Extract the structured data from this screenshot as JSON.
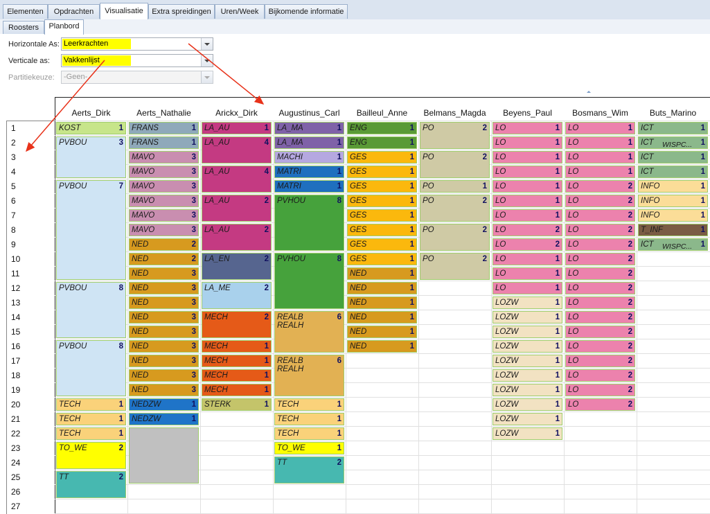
{
  "tabs": [
    "Elementen",
    "Opdrachten",
    "Visualisatie",
    "Extra spreidingen",
    "Uren/Week",
    "Bijkomende informatie"
  ],
  "active_tab": "Visualisatie",
  "subtabs": [
    "Roosters",
    "Planbord"
  ],
  "active_subtab": "Planbord",
  "filters": {
    "horizontal_label": "Horizontale As:",
    "horizontal_value": "Leerkrachten",
    "vertical_label": "Verticale as:",
    "vertical_value": "Vakkenlijst",
    "partition_label": "Partitiekeuze:",
    "partition_value": "-Geen-",
    "highlight_color": "#ffff00"
  },
  "columns": [
    "Aerts_Dirk",
    "Aerts_Nathalie",
    "Arickx_Dirk",
    "Augustinus_Carl",
    "Bailleul_Anne",
    "Belmans_Magda",
    "Beyens_Paul",
    "Bosmans_Wim",
    "Buts_Marino"
  ],
  "rows": [
    "1",
    "2",
    "3",
    "4",
    "5",
    "6",
    "7",
    "8",
    "9",
    "10",
    "11",
    "12",
    "13",
    "14",
    "15",
    "16",
    "17",
    "18",
    "19",
    "20",
    "21",
    "22",
    "23",
    "24",
    "25",
    "26",
    "27"
  ],
  "colors": {
    "KOST": "#c7e58a",
    "PVBOU": "#cfe4f4",
    "TECH": "#fad27a",
    "TO_WE": "#ffff00",
    "TT": "#47b8b0",
    "FRANS": "#8fa9ba",
    "MAVO": "#c98eb0",
    "NED": "#d79a1f",
    "NEDZW": "#1f74c8",
    "GRIJS": "#c0c0c0",
    "LA_AU": "#c43a82",
    "LA_EN": "#56658f",
    "LA_ME": "#a9d1ec",
    "MECH": "#e55a18",
    "STERK": "#c4c46a",
    "LA_MA": "#7f62a8",
    "MACHI": "#b5a8e0",
    "MATRI": "#1f6fbf",
    "PVHOU": "#46a23c",
    "REALB": "#e2b153",
    "ENG": "#5a9a36",
    "GES": "#fbb80d",
    "PO": "#cfcaa5",
    "LO": "#ec82ad",
    "LOZW": "#f2e2c2",
    "ICT": "#8bb88b",
    "INFO": "#fbdd98",
    "T_INF": "#7a5c44"
  },
  "blocks": [
    {
      "col": 0,
      "row": 1,
      "span": 1,
      "name": "KOST",
      "count": "1",
      "color": "KOST"
    },
    {
      "col": 0,
      "row": 2,
      "span": 3,
      "name": "PVBOU",
      "count": "3",
      "color": "PVBOU"
    },
    {
      "col": 0,
      "row": 5,
      "span": 7,
      "name": "PVBOU",
      "count": "7",
      "color": "PVBOU"
    },
    {
      "col": 0,
      "row": 12,
      "span": 4,
      "name": "PVBOU",
      "count": "8",
      "color": "PVBOU"
    },
    {
      "col": 0,
      "row": 16,
      "span": 4,
      "name": "PVBOU",
      "count": "8",
      "color": "PVBOU"
    },
    {
      "col": 0,
      "row": 20,
      "span": 1,
      "name": "TECH",
      "count": "1",
      "color": "TECH"
    },
    {
      "col": 0,
      "row": 21,
      "span": 1,
      "name": "TECH",
      "count": "1",
      "color": "TECH"
    },
    {
      "col": 0,
      "row": 22,
      "span": 1,
      "name": "TECH",
      "count": "1",
      "color": "TECH"
    },
    {
      "col": 0,
      "row": 23,
      "span": 2,
      "name": "TO_WE",
      "count": "2",
      "color": "TO_WE"
    },
    {
      "col": 0,
      "row": 25,
      "span": 2,
      "name": "TT",
      "count": "2",
      "color": "TT"
    },
    {
      "col": 1,
      "row": 1,
      "span": 1,
      "name": "FRANS",
      "count": "1",
      "color": "FRANS"
    },
    {
      "col": 1,
      "row": 2,
      "span": 1,
      "name": "FRANS",
      "count": "1",
      "color": "FRANS"
    },
    {
      "col": 1,
      "row": 3,
      "span": 1,
      "name": "MAVO",
      "count": "3",
      "color": "MAVO"
    },
    {
      "col": 1,
      "row": 4,
      "span": 1,
      "name": "MAVO",
      "count": "3",
      "color": "MAVO"
    },
    {
      "col": 1,
      "row": 5,
      "span": 1,
      "name": "MAVO",
      "count": "3",
      "color": "MAVO"
    },
    {
      "col": 1,
      "row": 6,
      "span": 1,
      "name": "MAVO",
      "count": "3",
      "color": "MAVO"
    },
    {
      "col": 1,
      "row": 7,
      "span": 1,
      "name": "MAVO",
      "count": "3",
      "color": "MAVO"
    },
    {
      "col": 1,
      "row": 8,
      "span": 1,
      "name": "MAVO",
      "count": "3",
      "color": "MAVO"
    },
    {
      "col": 1,
      "row": 9,
      "span": 1,
      "name": "NED",
      "count": "2",
      "color": "NED"
    },
    {
      "col": 1,
      "row": 10,
      "span": 1,
      "name": "NED",
      "count": "2",
      "color": "NED"
    },
    {
      "col": 1,
      "row": 11,
      "span": 1,
      "name": "NED",
      "count": "3",
      "color": "NED"
    },
    {
      "col": 1,
      "row": 12,
      "span": 1,
      "name": "NED",
      "count": "3",
      "color": "NED"
    },
    {
      "col": 1,
      "row": 13,
      "span": 1,
      "name": "NED",
      "count": "3",
      "color": "NED"
    },
    {
      "col": 1,
      "row": 14,
      "span": 1,
      "name": "NED",
      "count": "3",
      "color": "NED"
    },
    {
      "col": 1,
      "row": 15,
      "span": 1,
      "name": "NED",
      "count": "3",
      "color": "NED"
    },
    {
      "col": 1,
      "row": 16,
      "span": 1,
      "name": "NED",
      "count": "3",
      "color": "NED"
    },
    {
      "col": 1,
      "row": 17,
      "span": 1,
      "name": "NED",
      "count": "3",
      "color": "NED"
    },
    {
      "col": 1,
      "row": 18,
      "span": 1,
      "name": "NED",
      "count": "3",
      "color": "NED"
    },
    {
      "col": 1,
      "row": 19,
      "span": 1,
      "name": "NED",
      "count": "3",
      "color": "NED"
    },
    {
      "col": 1,
      "row": 20,
      "span": 1,
      "name": "NEDZW",
      "count": "1",
      "color": "NEDZW"
    },
    {
      "col": 1,
      "row": 21,
      "span": 1,
      "name": "NEDZW",
      "count": "1",
      "color": "NEDZW"
    },
    {
      "col": 1,
      "row": 22,
      "span": 4,
      "name": "",
      "count": "",
      "color": "GRIJS"
    },
    {
      "col": 2,
      "row": 1,
      "span": 1,
      "name": "LA_AU",
      "count": "1",
      "color": "LA_AU"
    },
    {
      "col": 2,
      "row": 2,
      "span": 2,
      "name": "LA_AU",
      "count": "4",
      "color": "LA_AU"
    },
    {
      "col": 2,
      "row": 4,
      "span": 2,
      "name": "LA_AU",
      "count": "4",
      "color": "LA_AU"
    },
    {
      "col": 2,
      "row": 6,
      "span": 2,
      "name": "LA_AU",
      "count": "2",
      "color": "LA_AU"
    },
    {
      "col": 2,
      "row": 8,
      "span": 2,
      "name": "LA_AU",
      "count": "2",
      "color": "LA_AU"
    },
    {
      "col": 2,
      "row": 10,
      "span": 2,
      "name": "LA_EN",
      "count": "2",
      "color": "LA_EN"
    },
    {
      "col": 2,
      "row": 12,
      "span": 2,
      "name": "LA_ME",
      "count": "2",
      "color": "LA_ME"
    },
    {
      "col": 2,
      "row": 14,
      "span": 2,
      "name": "MECH",
      "count": "2",
      "color": "MECH"
    },
    {
      "col": 2,
      "row": 16,
      "span": 1,
      "name": "MECH",
      "count": "1",
      "color": "MECH"
    },
    {
      "col": 2,
      "row": 17,
      "span": 1,
      "name": "MECH",
      "count": "1",
      "color": "MECH"
    },
    {
      "col": 2,
      "row": 18,
      "span": 1,
      "name": "MECH",
      "count": "1",
      "color": "MECH"
    },
    {
      "col": 2,
      "row": 19,
      "span": 1,
      "name": "MECH",
      "count": "1",
      "color": "MECH"
    },
    {
      "col": 2,
      "row": 20,
      "span": 1,
      "name": "STERK",
      "count": "1",
      "color": "STERK"
    },
    {
      "col": 3,
      "row": 1,
      "span": 1,
      "name": "LA_MA",
      "count": "1",
      "color": "LA_MA"
    },
    {
      "col": 3,
      "row": 2,
      "span": 1,
      "name": "LA_MA",
      "count": "1",
      "color": "LA_MA"
    },
    {
      "col": 3,
      "row": 3,
      "span": 1,
      "name": "MACHI",
      "count": "1",
      "color": "MACHI"
    },
    {
      "col": 3,
      "row": 4,
      "span": 1,
      "name": "MATRI",
      "count": "1",
      "color": "MATRI"
    },
    {
      "col": 3,
      "row": 5,
      "span": 1,
      "name": "MATRI",
      "count": "1",
      "color": "MATRI"
    },
    {
      "col": 3,
      "row": 6,
      "span": 4,
      "name": "PVHOU",
      "count": "8",
      "color": "PVHOU"
    },
    {
      "col": 3,
      "row": 10,
      "span": 4,
      "name": "PVHOU",
      "count": "8",
      "color": "PVHOU"
    },
    {
      "col": 3,
      "row": 14,
      "span": 3,
      "name": "REALB\nREALH",
      "count": "6",
      "color": "REALB"
    },
    {
      "col": 3,
      "row": 17,
      "span": 3,
      "name": "REALB\nREALH",
      "count": "6",
      "color": "REALB"
    },
    {
      "col": 3,
      "row": 20,
      "span": 1,
      "name": "TECH",
      "count": "1",
      "color": "TECH"
    },
    {
      "col": 3,
      "row": 21,
      "span": 1,
      "name": "TECH",
      "count": "1",
      "color": "TECH"
    },
    {
      "col": 3,
      "row": 22,
      "span": 1,
      "name": "TECH",
      "count": "1",
      "color": "TECH"
    },
    {
      "col": 3,
      "row": 23,
      "span": 1,
      "name": "TO_WE",
      "count": "1",
      "color": "TO_WE"
    },
    {
      "col": 3,
      "row": 24,
      "span": 2,
      "name": "TT",
      "count": "2",
      "color": "TT"
    },
    {
      "col": 4,
      "row": 1,
      "span": 1,
      "name": "ENG",
      "count": "1",
      "color": "ENG"
    },
    {
      "col": 4,
      "row": 2,
      "span": 1,
      "name": "ENG",
      "count": "1",
      "color": "ENG"
    },
    {
      "col": 4,
      "row": 3,
      "span": 1,
      "name": "GES",
      "count": "1",
      "color": "GES"
    },
    {
      "col": 4,
      "row": 4,
      "span": 1,
      "name": "GES",
      "count": "1",
      "color": "GES"
    },
    {
      "col": 4,
      "row": 5,
      "span": 1,
      "name": "GES",
      "count": "1",
      "color": "GES"
    },
    {
      "col": 4,
      "row": 6,
      "span": 1,
      "name": "GES",
      "count": "1",
      "color": "GES"
    },
    {
      "col": 4,
      "row": 7,
      "span": 1,
      "name": "GES",
      "count": "1",
      "color": "GES"
    },
    {
      "col": 4,
      "row": 8,
      "span": 1,
      "name": "GES",
      "count": "1",
      "color": "GES"
    },
    {
      "col": 4,
      "row": 9,
      "span": 1,
      "name": "GES",
      "count": "1",
      "color": "GES"
    },
    {
      "col": 4,
      "row": 10,
      "span": 1,
      "name": "GES",
      "count": "1",
      "color": "GES"
    },
    {
      "col": 4,
      "row": 11,
      "span": 1,
      "name": "NED",
      "count": "1",
      "color": "NED"
    },
    {
      "col": 4,
      "row": 12,
      "span": 1,
      "name": "NED",
      "count": "1",
      "color": "NED"
    },
    {
      "col": 4,
      "row": 13,
      "span": 1,
      "name": "NED",
      "count": "1",
      "color": "NED"
    },
    {
      "col": 4,
      "row": 14,
      "span": 1,
      "name": "NED",
      "count": "1",
      "color": "NED"
    },
    {
      "col": 4,
      "row": 15,
      "span": 1,
      "name": "NED",
      "count": "1",
      "color": "NED"
    },
    {
      "col": 4,
      "row": 16,
      "span": 1,
      "name": "NED",
      "count": "1",
      "color": "NED"
    },
    {
      "col": 5,
      "row": 1,
      "span": 2,
      "name": "PO",
      "count": "2",
      "color": "PO"
    },
    {
      "col": 5,
      "row": 3,
      "span": 2,
      "name": "PO",
      "count": "2",
      "color": "PO"
    },
    {
      "col": 5,
      "row": 5,
      "span": 1,
      "name": "PO",
      "count": "1",
      "color": "PO"
    },
    {
      "col": 5,
      "row": 6,
      "span": 2,
      "name": "PO",
      "count": "2",
      "color": "PO"
    },
    {
      "col": 5,
      "row": 8,
      "span": 2,
      "name": "PO",
      "count": "2",
      "color": "PO"
    },
    {
      "col": 5,
      "row": 10,
      "span": 2,
      "name": "PO",
      "count": "2",
      "color": "PO"
    },
    {
      "col": 6,
      "row": 1,
      "span": 1,
      "name": "LO",
      "count": "1",
      "color": "LO"
    },
    {
      "col": 6,
      "row": 2,
      "span": 1,
      "name": "LO",
      "count": "1",
      "color": "LO"
    },
    {
      "col": 6,
      "row": 3,
      "span": 1,
      "name": "LO",
      "count": "1",
      "color": "LO"
    },
    {
      "col": 6,
      "row": 4,
      "span": 1,
      "name": "LO",
      "count": "1",
      "color": "LO"
    },
    {
      "col": 6,
      "row": 5,
      "span": 1,
      "name": "LO",
      "count": "1",
      "color": "LO"
    },
    {
      "col": 6,
      "row": 6,
      "span": 1,
      "name": "LO",
      "count": "1",
      "color": "LO"
    },
    {
      "col": 6,
      "row": 7,
      "span": 1,
      "name": "LO",
      "count": "1",
      "color": "LO"
    },
    {
      "col": 6,
      "row": 8,
      "span": 1,
      "name": "LO",
      "count": "2",
      "color": "LO"
    },
    {
      "col": 6,
      "row": 9,
      "span": 1,
      "name": "LO",
      "count": "2",
      "color": "LO"
    },
    {
      "col": 6,
      "row": 10,
      "span": 1,
      "name": "LO",
      "count": "1",
      "color": "LO"
    },
    {
      "col": 6,
      "row": 11,
      "span": 1,
      "name": "LO",
      "count": "1",
      "color": "LO"
    },
    {
      "col": 6,
      "row": 12,
      "span": 1,
      "name": "LO",
      "count": "1",
      "color": "LO"
    },
    {
      "col": 6,
      "row": 13,
      "span": 1,
      "name": "LOZW",
      "count": "1",
      "color": "LOZW"
    },
    {
      "col": 6,
      "row": 14,
      "span": 1,
      "name": "LOZW",
      "count": "1",
      "color": "LOZW"
    },
    {
      "col": 6,
      "row": 15,
      "span": 1,
      "name": "LOZW",
      "count": "1",
      "color": "LOZW"
    },
    {
      "col": 6,
      "row": 16,
      "span": 1,
      "name": "LOZW",
      "count": "1",
      "color": "LOZW"
    },
    {
      "col": 6,
      "row": 17,
      "span": 1,
      "name": "LOZW",
      "count": "1",
      "color": "LOZW"
    },
    {
      "col": 6,
      "row": 18,
      "span": 1,
      "name": "LOZW",
      "count": "1",
      "color": "LOZW"
    },
    {
      "col": 6,
      "row": 19,
      "span": 1,
      "name": "LOZW",
      "count": "1",
      "color": "LOZW"
    },
    {
      "col": 6,
      "row": 20,
      "span": 1,
      "name": "LOZW",
      "count": "1",
      "color": "LOZW"
    },
    {
      "col": 6,
      "row": 21,
      "span": 1,
      "name": "LOZW",
      "count": "1",
      "color": "LOZW"
    },
    {
      "col": 6,
      "row": 22,
      "span": 1,
      "name": "LOZW",
      "count": "1",
      "color": "LOZW"
    },
    {
      "col": 7,
      "row": 1,
      "span": 1,
      "name": "LO",
      "count": "1",
      "color": "LO"
    },
    {
      "col": 7,
      "row": 2,
      "span": 1,
      "name": "LO",
      "count": "1",
      "color": "LO"
    },
    {
      "col": 7,
      "row": 3,
      "span": 1,
      "name": "LO",
      "count": "1",
      "color": "LO"
    },
    {
      "col": 7,
      "row": 4,
      "span": 1,
      "name": "LO",
      "count": "1",
      "color": "LO"
    },
    {
      "col": 7,
      "row": 5,
      "span": 1,
      "name": "LO",
      "count": "2",
      "color": "LO"
    },
    {
      "col": 7,
      "row": 6,
      "span": 1,
      "name": "LO",
      "count": "2",
      "color": "LO"
    },
    {
      "col": 7,
      "row": 7,
      "span": 1,
      "name": "LO",
      "count": "2",
      "color": "LO"
    },
    {
      "col": 7,
      "row": 8,
      "span": 1,
      "name": "LO",
      "count": "2",
      "color": "LO"
    },
    {
      "col": 7,
      "row": 9,
      "span": 1,
      "name": "LO",
      "count": "2",
      "color": "LO"
    },
    {
      "col": 7,
      "row": 10,
      "span": 1,
      "name": "LO",
      "count": "2",
      "color": "LO"
    },
    {
      "col": 7,
      "row": 11,
      "span": 1,
      "name": "LO",
      "count": "2",
      "color": "LO"
    },
    {
      "col": 7,
      "row": 12,
      "span": 1,
      "name": "LO",
      "count": "2",
      "color": "LO"
    },
    {
      "col": 7,
      "row": 13,
      "span": 1,
      "name": "LO",
      "count": "2",
      "color": "LO"
    },
    {
      "col": 7,
      "row": 14,
      "span": 1,
      "name": "LO",
      "count": "2",
      "color": "LO"
    },
    {
      "col": 7,
      "row": 15,
      "span": 1,
      "name": "LO",
      "count": "2",
      "color": "LO"
    },
    {
      "col": 7,
      "row": 16,
      "span": 1,
      "name": "LO",
      "count": "2",
      "color": "LO"
    },
    {
      "col": 7,
      "row": 17,
      "span": 1,
      "name": "LO",
      "count": "2",
      "color": "LO"
    },
    {
      "col": 7,
      "row": 18,
      "span": 1,
      "name": "LO",
      "count": "2",
      "color": "LO"
    },
    {
      "col": 7,
      "row": 19,
      "span": 1,
      "name": "LO",
      "count": "2",
      "color": "LO"
    },
    {
      "col": 7,
      "row": 20,
      "span": 1,
      "name": "LO",
      "count": "2",
      "color": "LO"
    },
    {
      "col": 8,
      "row": 1,
      "span": 1,
      "name": "ICT",
      "count": "1",
      "color": "ICT"
    },
    {
      "col": 8,
      "row": 2,
      "span": 1,
      "name": "ICT",
      "extra": "WISPC...",
      "count": "1",
      "color": "ICT"
    },
    {
      "col": 8,
      "row": 3,
      "span": 1,
      "name": "ICT",
      "count": "1",
      "color": "ICT"
    },
    {
      "col": 8,
      "row": 4,
      "span": 1,
      "name": "ICT",
      "count": "1",
      "color": "ICT"
    },
    {
      "col": 8,
      "row": 5,
      "span": 1,
      "name": "INFO",
      "count": "1",
      "color": "INFO"
    },
    {
      "col": 8,
      "row": 6,
      "span": 1,
      "name": "INFO",
      "count": "1",
      "color": "INFO"
    },
    {
      "col": 8,
      "row": 7,
      "span": 1,
      "name": "INFO",
      "count": "1",
      "color": "INFO"
    },
    {
      "col": 8,
      "row": 8,
      "span": 1,
      "name": "T_INF",
      "count": "1",
      "color": "T_INF"
    },
    {
      "col": 8,
      "row": 9,
      "span": 1,
      "name": "ICT",
      "extra": "WISPC...",
      "count": "1",
      "color": "ICT"
    }
  ]
}
